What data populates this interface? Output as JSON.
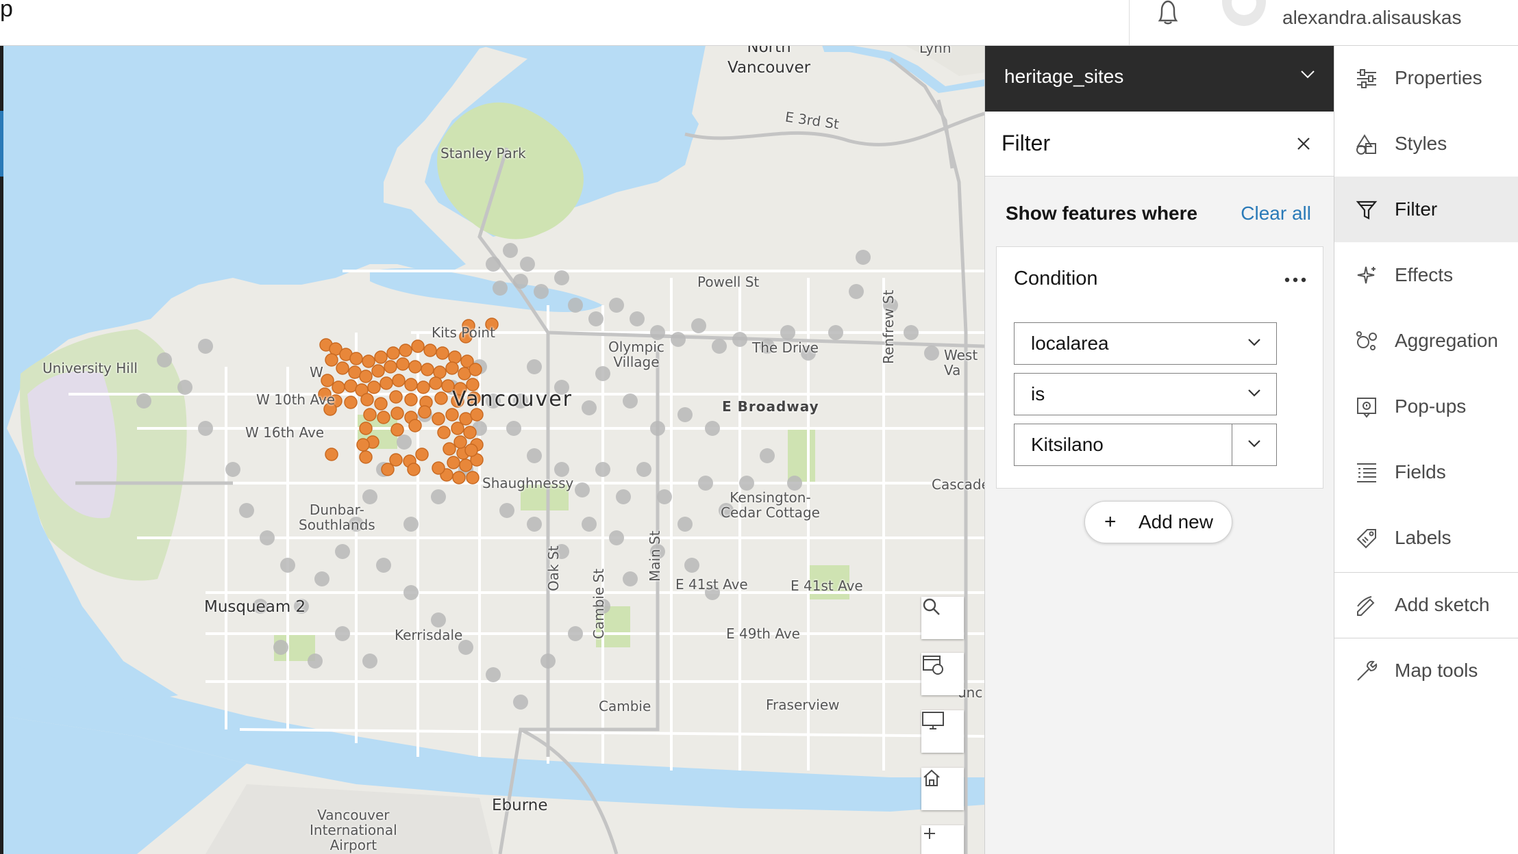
{
  "header": {
    "app_letter": "p",
    "username": "alexandra.alisauskas",
    "icons": [
      "bell-icon",
      "avatar"
    ]
  },
  "map": {
    "labels": {
      "north_vancouver": "North\nVancouver",
      "e3rd": "E 3rd St",
      "stanley_park": "Stanley Park",
      "powell": "Powell St",
      "renfrew": "Renfrew St",
      "university_hill": "University Hill",
      "kits_point": "Kits Point",
      "olympic_village": "Olympic\nVillage",
      "the_drive": "The Drive",
      "west_va": "West\nVa",
      "w10th": "W 10th Ave",
      "vancouver": "Vancouver",
      "e_broadway": "E Broadway",
      "w16th": "W 16th Ave",
      "shaughnessy": "Shaughnessy",
      "dunbar": "Dunbar-\nSouthlands",
      "kensington": "Kensington-\nCedar Cottage",
      "cascade": "Cascade",
      "oak": "Oak St",
      "cambie_st": "Cambie St",
      "main": "Main St",
      "e41_1": "E 41st Ave",
      "e41_2": "E 41st Ave",
      "musqueam": "Musqueam 2",
      "kerrisdale": "Kerrisdale",
      "e49": "E 49th Ave",
      "cambie": "Cambie",
      "fraserview": "Fraserview",
      "eburne": "Eburne",
      "yvr": "Vancouver\nInternational\nAirport",
      "w_partial": "W",
      "lynn": "Lynn",
      "unc": "unc"
    },
    "controls": [
      "search-icon",
      "basemap-icon",
      "screen-icon",
      "home-icon",
      "zoom-in-icon"
    ],
    "colors": {
      "water": "#b7dcf5",
      "land": "#ecebe6",
      "park": "#cfe3b2",
      "feature": "#e8873a",
      "filtered_out": "#b9b9b9"
    }
  },
  "layer_panel": {
    "layer_name": "heritage_sites",
    "filter_title": "Filter",
    "show_features_where": "Show features where",
    "clear_all": "Clear all",
    "condition": {
      "title": "Condition",
      "field": "localarea",
      "operator": "is",
      "value": "Kitsilano"
    },
    "add_new": "Add new"
  },
  "right_nav": {
    "items": [
      {
        "label": "Properties",
        "icon": "properties-icon",
        "active": false
      },
      {
        "label": "Styles",
        "icon": "styles-icon",
        "active": false
      },
      {
        "label": "Filter",
        "icon": "filter-icon",
        "active": true
      },
      {
        "label": "Effects",
        "icon": "effects-icon",
        "active": false
      },
      {
        "label": "Aggregation",
        "icon": "aggregation-icon",
        "active": false
      },
      {
        "label": "Pop-ups",
        "icon": "popups-icon",
        "active": false
      },
      {
        "label": "Fields",
        "icon": "fields-icon",
        "active": false
      },
      {
        "label": "Labels",
        "icon": "labels-icon",
        "active": false
      },
      {
        "label": "Add sketch",
        "icon": "sketch-icon",
        "active": false
      },
      {
        "label": "Map tools",
        "icon": "map-tools-icon",
        "active": false
      }
    ]
  }
}
